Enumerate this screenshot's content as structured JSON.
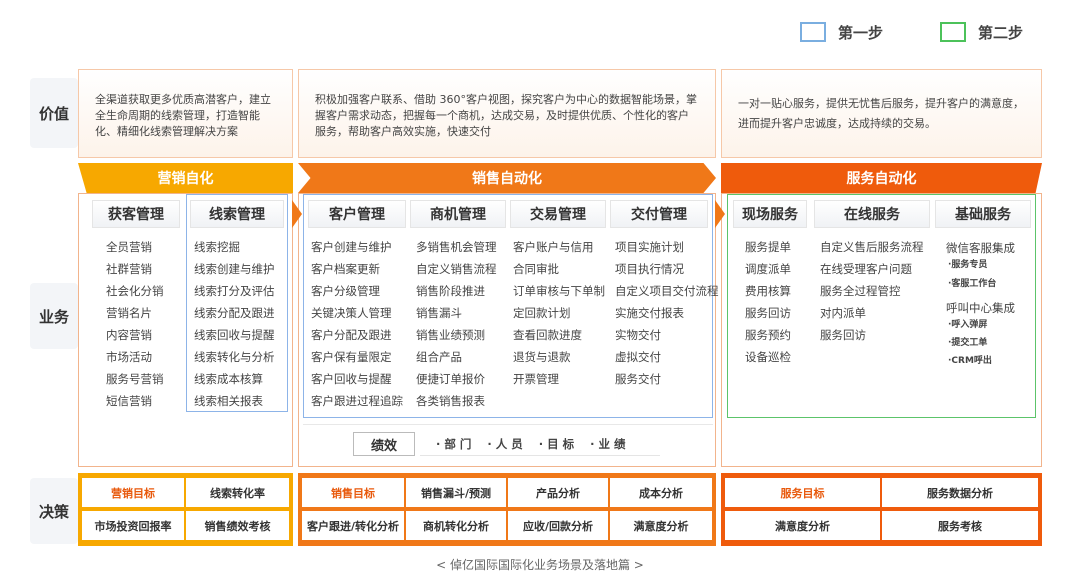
{
  "legend": [
    {
      "label": "第一步",
      "color": "#7aaee0"
    },
    {
      "label": "第二步",
      "color": "#4cc25a"
    }
  ],
  "rows": {
    "value": "价值",
    "business": "业务",
    "decision": "决策"
  },
  "values": [
    "全渠道获取更多优质高潜客户，建立全生命周期的线索管理，打造智能化、精细化线索管理解决方案",
    "积极加强客户联系、借助 360°客户视图，探究客户为中心的数据智能场景，掌握客户需求动态，把握每一个商机，达成交易，及时提供优质、个性化的客户服务，帮助客户高效实施，快速交付",
    "一对一贴心服务，提供无忧售后服务，提升客户的满意度，进而提升客户忠诚度，达成持续的交易。"
  ],
  "banners": [
    {
      "label": "营销自化",
      "color": "#f7a800"
    },
    {
      "label": "销售自动化",
      "color": "#f07818"
    },
    {
      "label": "服务自动化",
      "color": "#ef5b0c"
    }
  ],
  "sections": [
    {
      "title": "获客管理",
      "items": [
        "全员营销",
        "社群营销",
        "社会化分销",
        "营销名片",
        "内容营销",
        "市场活动",
        "服务号营销",
        "短信营销"
      ]
    },
    {
      "title": "线索管理",
      "items": [
        "线索挖掘",
        "线索创建与维护",
        "线索打分及评估",
        "线索分配及跟进",
        "线索回收与提醒",
        "线索转化与分析",
        "线索成本核算",
        "线索相关报表"
      ]
    },
    {
      "title": "客户管理",
      "items": [
        "客户创建与维护",
        "客户档案更新",
        "客户分级管理",
        "关键决策人管理",
        "客户分配及跟进",
        "客户保有量限定",
        "客户回收与提醒",
        "客户跟进过程追踪"
      ]
    },
    {
      "title": "商机管理",
      "items": [
        "多销售机会管理",
        "自定义销售流程",
        "销售阶段推进",
        "销售漏斗",
        "销售业绩预测",
        "组合产品",
        "便捷订单报价",
        "各类销售报表"
      ]
    },
    {
      "title": "交易管理",
      "items": [
        "客户账户与信用",
        "合同审批",
        "订单审核与下单制",
        "定回款计划",
        "查看回款进度",
        "退货与退款",
        "开票管理"
      ]
    },
    {
      "title": "交付管理",
      "items": [
        "项目实施计划",
        "项目执行情况",
        "自定义项目交付流程",
        "实施交付报表",
        "实物交付",
        "虚拟交付",
        "服务交付"
      ]
    },
    {
      "title": "现场服务",
      "items": [
        "服务提单",
        "调度派单",
        "费用核算",
        "服务回访",
        "服务预约",
        "设备巡检"
      ]
    },
    {
      "title": "在线服务",
      "items": [
        "自定义售后服务流程",
        "在线受理客户问题",
        "服务全过程管控",
        "对内派单",
        "服务回访"
      ]
    },
    {
      "title": "基础服务",
      "items": []
    }
  ],
  "basic_service": {
    "wechat": "微信客服集成",
    "wechat_subs": [
      "·服务专员",
      "·客服工作台"
    ],
    "callcenter": "呼叫中心集成",
    "callcenter_subs": [
      "·呼入弹屏",
      "·提交工单",
      "·CRM呼出"
    ]
  },
  "performance": {
    "label": "绩效",
    "items": [
      "· 部 门",
      "· 人 员",
      "· 目 标",
      "· 业 绩"
    ]
  },
  "decisions": {
    "marketing": [
      [
        "营销目标",
        "线索转化率"
      ],
      [
        "市场投资回报率",
        "销售绩效考核"
      ]
    ],
    "sales": [
      [
        "销售目标",
        "销售漏斗/预测",
        "产品分析",
        "成本分析"
      ],
      [
        "客户跟进/转化分析",
        "商机转化分析",
        "应收/回款分析",
        "满意度分析"
      ]
    ],
    "service": [
      [
        "服务目标",
        "服务数据分析"
      ],
      [
        "满意度分析",
        "服务考核"
      ]
    ]
  },
  "footer": "< 倬亿国际国际化业务场景及落地篇 >"
}
